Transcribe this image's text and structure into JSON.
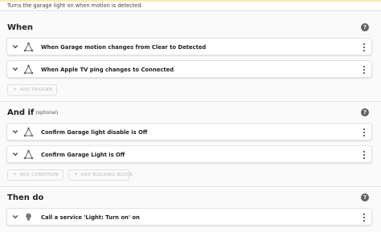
{
  "description": "Turns the garage light on when motion is detected.",
  "help_symbol": "?",
  "triggers": {
    "title": "When",
    "items": [
      {
        "label": "When Garage motion changes from Clear to Detected"
      },
      {
        "label": "When Apple TV ping changes to Connected"
      }
    ],
    "add_label": "ADD TRIGGER"
  },
  "conditions": {
    "title": "And if",
    "optional_label": "(optional)",
    "items": [
      {
        "label": "Confirm Garage light disable is Off"
      },
      {
        "label": "Confirm Garage Light is Off"
      }
    ],
    "add_condition_label": "ADD CONDITION",
    "add_block_label": "ADD BUILDING BLOCK"
  },
  "actions": {
    "title": "Then do",
    "items": [
      {
        "label": "Call a service 'Light: Turn on' on"
      }
    ]
  },
  "plus_symbol": "+"
}
